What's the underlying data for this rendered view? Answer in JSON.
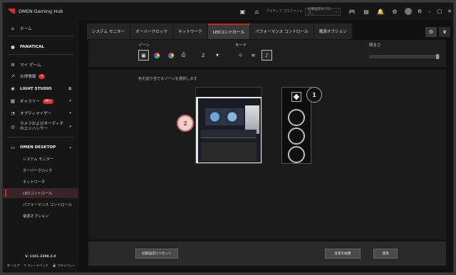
{
  "app": {
    "title": "OMEN Gaming Hub"
  },
  "titlebar": {
    "profile_label": "アクティブ プロファイル",
    "profile_value": "初期設定のプロフ..."
  },
  "sidebar": {
    "home": "ホーム",
    "brand": "FANATICAL",
    "my_games": "マイ ゲーム",
    "rewards": "お得情報",
    "rewards_badge": "9",
    "light_studio": "LIGHT STUDIO",
    "gallery": "ギャラリー",
    "gallery_badge": "99+",
    "optimizer": "オプティマイザー",
    "camera_audio": "カメラおよびオーディオのエンハンサー",
    "omen_desktop": "OMEN DESKTOP",
    "sub_items": [
      "システム モニター",
      "オーバークロック",
      "ネットワーク",
      "LEDコントロール",
      "パフォーマンス コントロール",
      "電源オプション"
    ],
    "version": "V. 1101.2308.2.0",
    "footer": [
      "ヘルプ",
      "フィードバック",
      "プライバシー"
    ]
  },
  "tabs": [
    "システム モニター",
    "オーバークロック",
    "ネットワーク",
    "LEDコントロール",
    "パフォーマンス コントロール",
    "電源オプション"
  ],
  "controls": {
    "zone_label": "ゾーン",
    "zone_value": "2",
    "mode_label": "モード",
    "brightness_label": "明るさ",
    "brightness_level": 0.98
  },
  "content": {
    "hint": "色を割り当てるゾーンを選択します",
    "callout_2": "2",
    "callout_1": "1"
  },
  "buttons": {
    "reset": "初期設定にリセット",
    "discard": "変更を破棄",
    "apply": "適用"
  }
}
